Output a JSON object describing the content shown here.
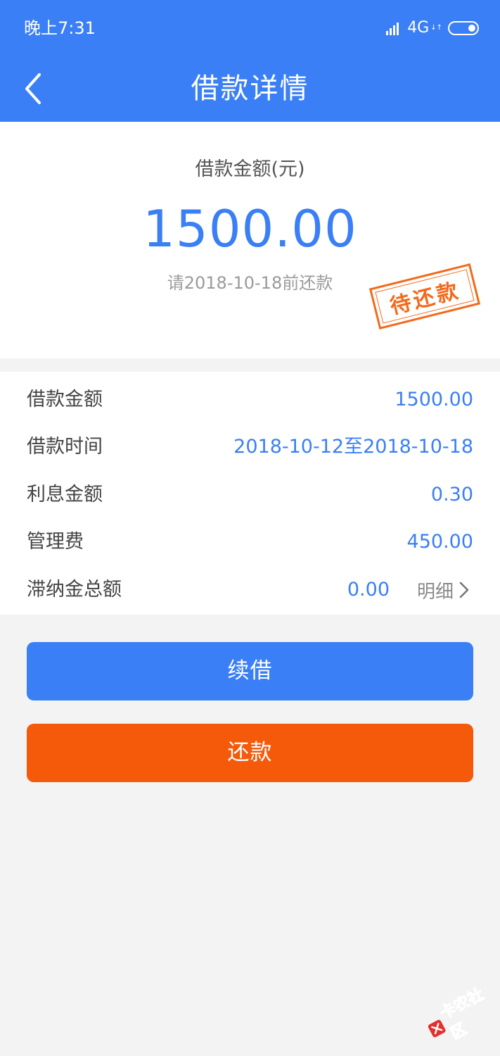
{
  "status_bar": {
    "time": "晚上7:31",
    "network": "4G",
    "network_sub": "↓↑"
  },
  "navbar": {
    "title": "借款详情"
  },
  "summary": {
    "label": "借款金额(元)",
    "amount": "1500.00",
    "due_text": "请2018-10-18前还款",
    "stamp_text": "待还款"
  },
  "details": [
    {
      "label": "借款金额",
      "value": "1500.00"
    },
    {
      "label": "借款时间",
      "value": "2018-10-12至2018-10-18"
    },
    {
      "label": "利息金额",
      "value": "0.30"
    },
    {
      "label": "管理费",
      "value": "450.00"
    },
    {
      "label": "滞纳金总额",
      "value": "0.00",
      "link": "明细"
    }
  ],
  "buttons": {
    "renew": "续借",
    "repay": "还款"
  },
  "watermark": {
    "text": "卡农社区"
  },
  "colors": {
    "primary": "#3a7ff6",
    "accent": "#f45a0a",
    "stamp": "#f26a1b"
  }
}
